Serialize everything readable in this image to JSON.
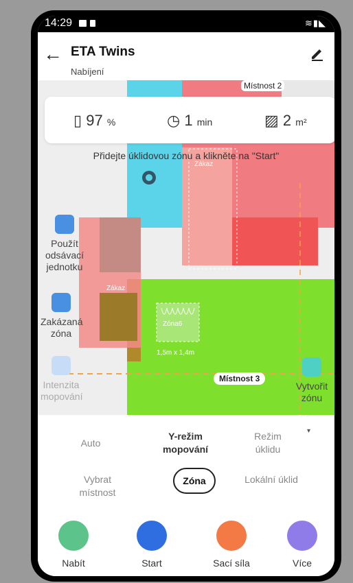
{
  "status_bar": {
    "time": "14:29"
  },
  "header": {
    "title": "ETA Twins",
    "subtitle": "Nabíjení"
  },
  "stats": {
    "battery_value": "97",
    "battery_unit": "%",
    "time_value": "1",
    "time_unit": "min",
    "area_value": "2",
    "area_unit": "m²"
  },
  "map": {
    "hint": "Přidejte úklidovou zónu a klikněte na \"Start\"",
    "room_labels": {
      "room2": "Místnost 2",
      "room3": "Místnost 3"
    },
    "no_go_label": "Zákaz",
    "zone_label": "Zóna6",
    "zone_size": "1,5m x 1,4m",
    "left_actions": [
      {
        "label": "Použít odsávací jednotku"
      },
      {
        "label": "Zakázaná zóna"
      },
      {
        "label": "Intenzita mopování"
      }
    ],
    "create_zone": {
      "label": "Vytvořit zónu"
    }
  },
  "modes": {
    "row1": [
      "Auto",
      "Y-režim mopování",
      "Režim úklidu"
    ],
    "row2": [
      "Vybrat místnost",
      "Zóna",
      "Lokální úklid"
    ]
  },
  "bottom_bar": [
    {
      "label": "Nabít",
      "color": "#5cc38a"
    },
    {
      "label": "Start",
      "color": "#2f6ee0"
    },
    {
      "label": "Sací síla",
      "color": "#f37a45"
    },
    {
      "label": "Více",
      "color": "#8f7ce8"
    }
  ]
}
